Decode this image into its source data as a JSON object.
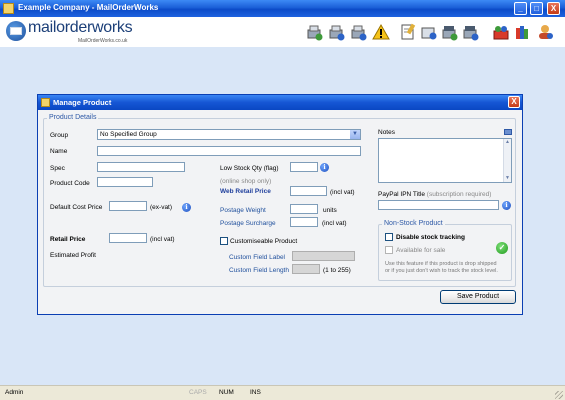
{
  "window": {
    "title": "Example Company - MailOrderWorks",
    "min_label": "_",
    "max_label": "□",
    "close_label": "X"
  },
  "logo": {
    "brand": "mailorderworks",
    "url": "MailOrderWorks.co.uk"
  },
  "toolbar": {
    "icons": [
      "orders-icon",
      "customers-icon",
      "products-icon",
      "warning-icon",
      "reports-icon",
      "stock-icon",
      "add-stock-icon",
      "despatch-icon",
      "sales-channels-icon",
      "books-icon",
      "users-icon"
    ]
  },
  "dialog": {
    "title": "Manage Product",
    "close_label": "X",
    "section_title": "Product Details",
    "group_label": "Group",
    "group_value": "No Specified Group",
    "name_label": "Name",
    "name_value": "",
    "spec_label": "Spec",
    "spec_value": "",
    "code_label": "Product Code",
    "code_value": "",
    "cost_label": "Default Cost Price",
    "cost_value": "",
    "cost_suffix": "(ex-vat)",
    "retail_label": "Retail Price",
    "retail_value": "",
    "retail_suffix": "(incl vat)",
    "profit_label": "Estimated Profit",
    "lowstock_label": "Low Stock Qty (flag)",
    "lowstock_value": "",
    "online_note": "(online shop only)",
    "web_retail_label": "Web Retail Price",
    "web_retail_value": "",
    "web_retail_suffix": "(incl vat)",
    "weight_label": "Postage Weight",
    "weight_value": "",
    "weight_suffix": "units",
    "surcharge_label": "Postage Surcharge",
    "surcharge_value": "",
    "surcharge_suffix": "(incl vat)",
    "customise_label": "Customiseable Product",
    "custom_label_label": "Custom Field Label",
    "custom_label_value": "",
    "custom_length_label": "Custom Field Length",
    "custom_length_value": "",
    "custom_length_suffix": "(1 to 255)",
    "notes_label": "Notes",
    "notes_value": "",
    "paypal_label": "PayPal IPN Title",
    "paypal_hint": "(subscription required)",
    "paypal_value": "",
    "nonstock_title": "Non-Stock Product",
    "disable_tracking_label": "Disable stock tracking",
    "available_label": "Available for sale",
    "nonstock_note_1": "Use this feature if this product is drop shipped",
    "nonstock_note_2": "or if you just don't wish to track the stock level.",
    "save_label": "Save Product",
    "info_glyph": "i",
    "ok_glyph": "✓"
  },
  "status": {
    "user": "Admin",
    "caps": "CAPS",
    "num": "NUM",
    "ins": "INS"
  },
  "colors": {
    "titlebar": "#1b5fd8",
    "workspace": "#d9e6f7",
    "dialog_bg": "#f2f3f5",
    "label_blue": "#1f4f9c"
  }
}
